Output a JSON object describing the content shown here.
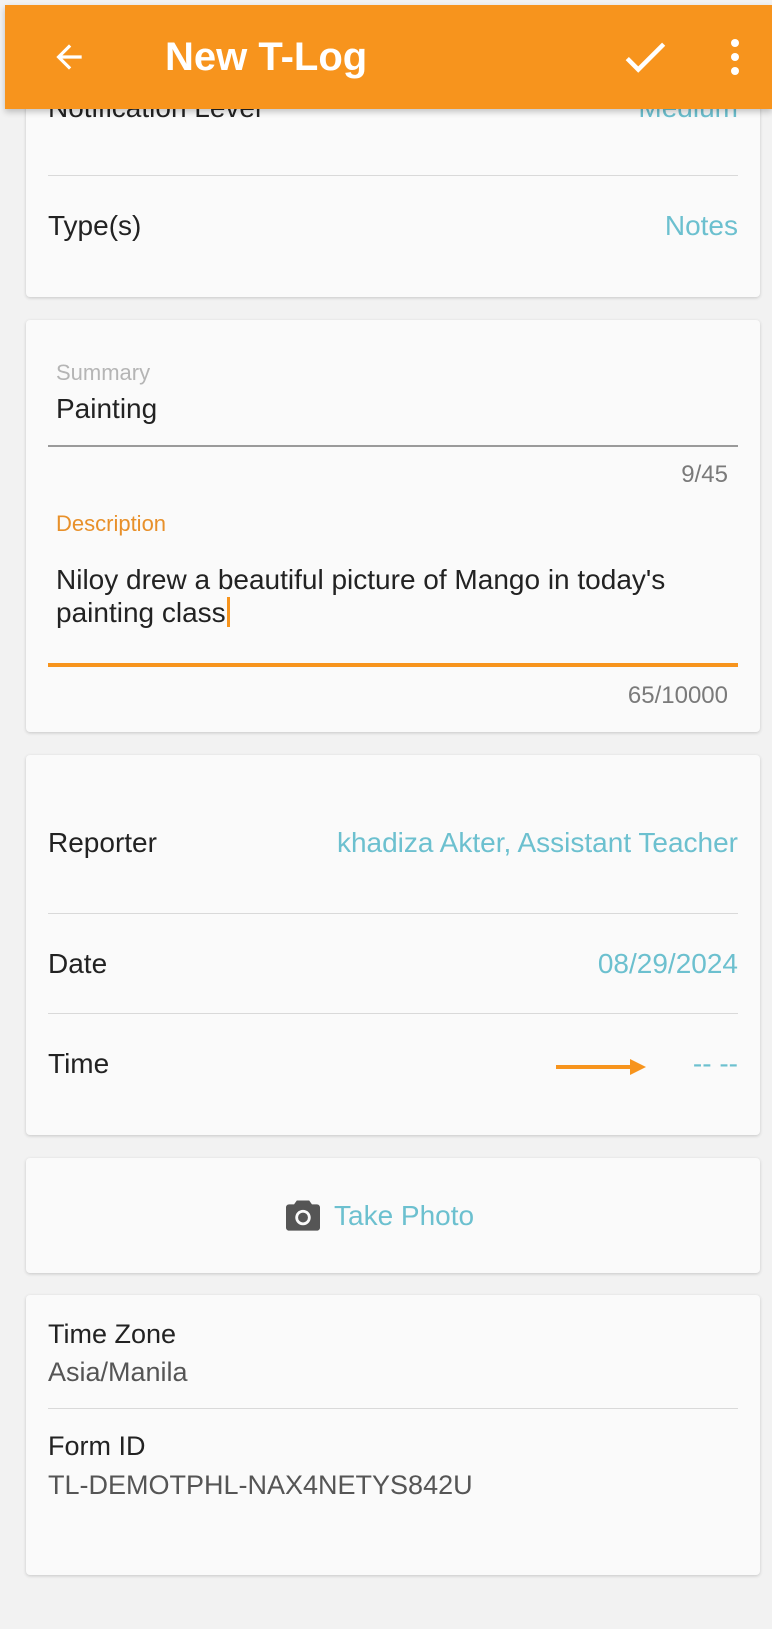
{
  "app_bar": {
    "title": "New T-Log",
    "back_icon": "arrow-left-icon",
    "confirm_icon": "check-icon",
    "menu_icon": "more-vertical-icon",
    "background_color": "#f7941d"
  },
  "settings": {
    "notification_level_label": "Notification Level",
    "notification_level_value": "Medium",
    "types_label": "Type(s)",
    "types_value": "Notes"
  },
  "summary": {
    "label": "Summary",
    "value": "Painting",
    "counter": "9/45"
  },
  "description": {
    "label": "Description",
    "value": "Niloy drew a beautiful picture of Mango in today's painting class",
    "counter": "65/10000"
  },
  "details": {
    "reporter_label": "Reporter",
    "reporter_value": "khadiza Akter, Assistant Teacher",
    "date_label": "Date",
    "date_value": "08/29/2024",
    "time_label": "Time",
    "time_value": "-- --"
  },
  "photo": {
    "label": "Take Photo",
    "icon": "camera-icon"
  },
  "info": {
    "timezone_label": "Time Zone",
    "timezone_value": "Asia/Manila",
    "form_id_label": "Form ID",
    "form_id_value": "TL-DEMOTPHL-NAX4NETYS842U"
  },
  "colors": {
    "accent": "#f7941d",
    "link": "#6cc0cf",
    "background": "#f2f2f2",
    "card": "#fafafa"
  }
}
